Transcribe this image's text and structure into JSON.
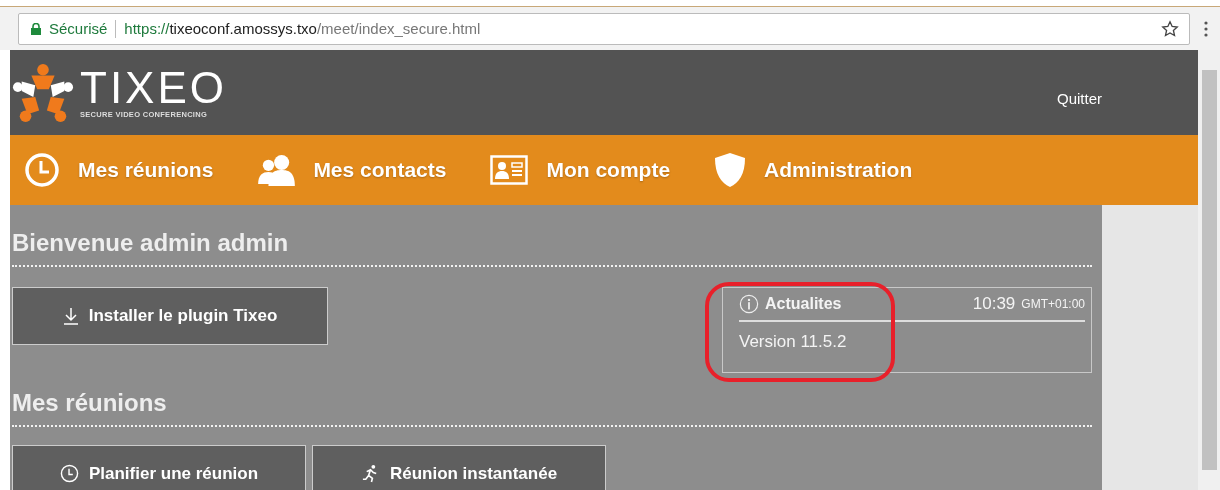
{
  "browser": {
    "security_label": "Sécurisé",
    "url": {
      "scheme": "https://",
      "host": "tixeoconf.amossys.txo",
      "path": "/meet/index_secure.html"
    }
  },
  "header": {
    "brand": "TIXEO",
    "tagline": "SECURE VIDEO CONFERENCING",
    "logout": "Quitter"
  },
  "nav": [
    {
      "label": "Mes réunions"
    },
    {
      "label": "Mes contacts"
    },
    {
      "label": "Mon compte"
    },
    {
      "label": "Administration"
    }
  ],
  "welcome": {
    "title": "Bienvenue admin admin",
    "install_button": "Installer le plugin Tixeo"
  },
  "news": {
    "title": "Actualites",
    "time": "10:39",
    "timezone": "GMT+01:00",
    "body": "Version 11.5.2",
    "highlighted": true
  },
  "meetings": {
    "title": "Mes réunions",
    "buttons": [
      {
        "label": "Planifier une réunion"
      },
      {
        "label": "Réunion instantanée"
      }
    ]
  }
}
